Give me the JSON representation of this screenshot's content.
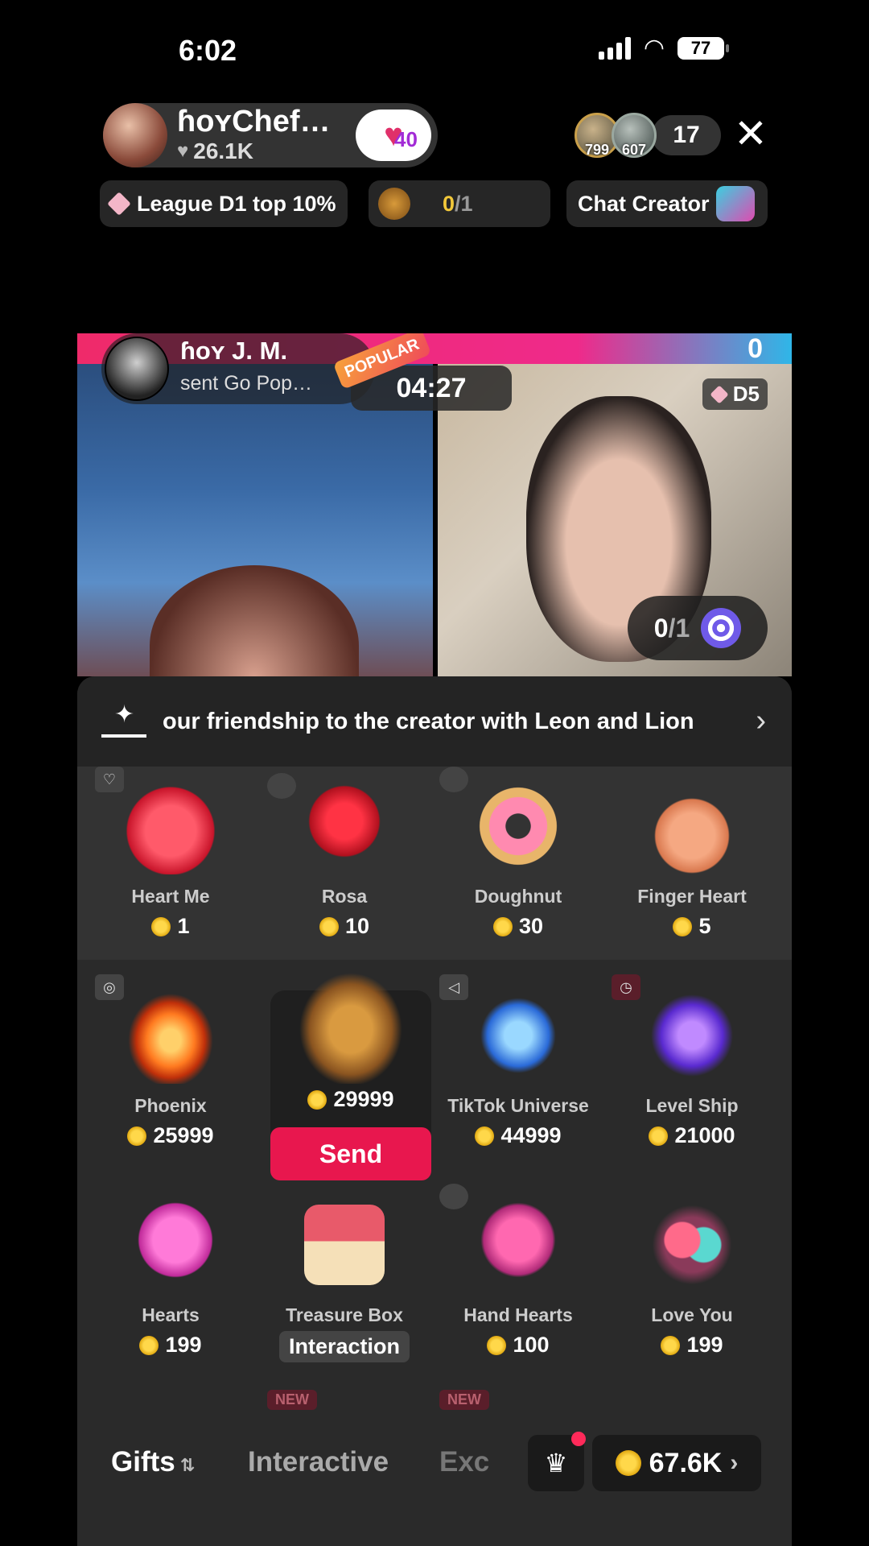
{
  "status": {
    "time": "6:02",
    "battery": "77"
  },
  "host": {
    "name": "ɦoʏChef…",
    "likes": "26.1K",
    "fan_level": "40"
  },
  "viewers": {
    "top1_score": "799",
    "top2_score": "607",
    "count": "17"
  },
  "chips": {
    "league": "League D1 top 10%",
    "goal_current": "0",
    "goal_total": "/1",
    "chat_creator": "Chat Creator"
  },
  "battle": {
    "score_right": "0",
    "sender_name": "ɦoʏ J. M.",
    "sender_text": "sent Go Pop…",
    "popular_badge": "POPULAR",
    "timer": "04:27",
    "opponent_rank": "D5",
    "target_current": "0",
    "target_total": "/1"
  },
  "banner": {
    "text": "our friendship to the creator with Leon and Lion"
  },
  "gifts": [
    {
      "name": "Heart Me",
      "price": "1",
      "icon": "heart-me-icon"
    },
    {
      "name": "Rosa",
      "price": "10",
      "icon": "rose-icon"
    },
    {
      "name": "Doughnut",
      "price": "30",
      "icon": "doughnut-icon"
    },
    {
      "name": "Finger Heart",
      "price": "5",
      "icon": "finger-heart-icon"
    },
    {
      "name": "Phoenix",
      "price": "25999",
      "icon": "phoenix-icon"
    },
    {
      "name": "",
      "price": "29999",
      "icon": "lion-icon"
    },
    {
      "name": "TikTok Universe",
      "price": "44999",
      "icon": "tiktok-universe-icon"
    },
    {
      "name": "Level Ship",
      "price": "21000",
      "icon": "level-ship-icon"
    },
    {
      "name": "Hearts",
      "price": "199",
      "icon": "hearts-icon"
    },
    {
      "name": "Treasure Box",
      "price": "",
      "icon": "treasure-box-icon"
    },
    {
      "name": "Hand Hearts",
      "price": "100",
      "icon": "hand-hearts-icon"
    },
    {
      "name": "Love You",
      "price": "199",
      "icon": "love-you-icon"
    }
  ],
  "buttons": {
    "send": "Send",
    "interaction": "Interaction"
  },
  "new_tag": "NEW",
  "tabs": {
    "gifts": "Gifts",
    "interactive": "Interactive",
    "exclusive": "Exc"
  },
  "balance": "67.6K",
  "colors": {
    "accent": "#e8174e",
    "panel": "#2a2a2a",
    "coin": "#ffd84a"
  }
}
